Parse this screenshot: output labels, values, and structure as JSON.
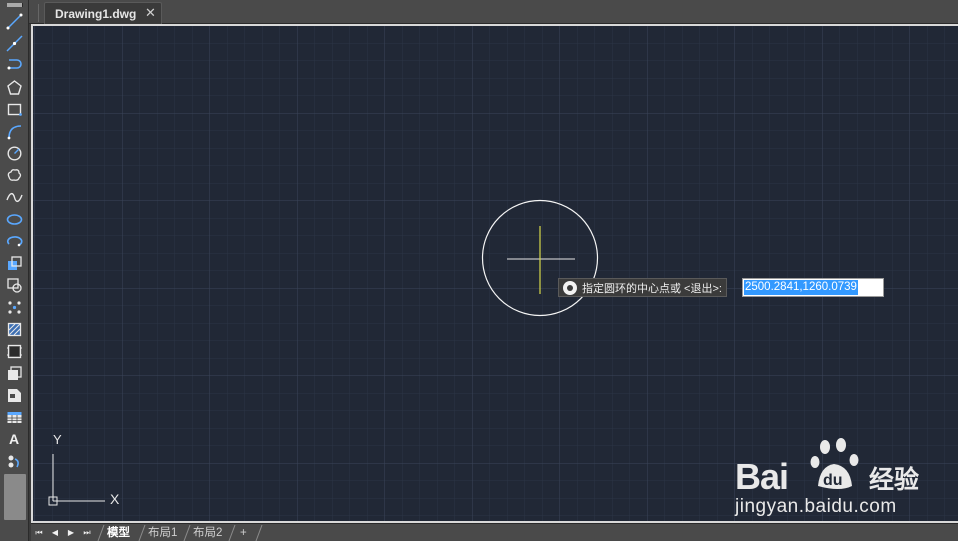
{
  "tab": {
    "title": "Drawing1.dwg",
    "close_glyph": "✕"
  },
  "toolbar": {
    "tools": [
      "line-icon",
      "construction-line-icon",
      "polyline-icon",
      "polygon-icon",
      "rectangle-icon",
      "arc-icon",
      "circle-icon",
      "revision-cloud-icon",
      "spline-icon",
      "ellipse-icon",
      "ellipse-arc-icon",
      "insert-block-icon",
      "make-block-icon",
      "point-icon",
      "hatch-icon",
      "gradient-icon",
      "region-icon",
      "wipeout-icon",
      "table-icon",
      "multiline-text-icon",
      "add-selected-icon"
    ],
    "text_tool": "A"
  },
  "command": {
    "prompt": "指定圆环的中心点或 <退出>:",
    "coordinates": "2500.2841,1260.0739"
  },
  "ucs": {
    "x_label": "X",
    "y_label": "Y"
  },
  "layout_tabs": {
    "model": "模型",
    "layout1": "布局1",
    "layout2": "布局2",
    "add": "+"
  },
  "nav": {
    "first": "⏮",
    "prev": "◀",
    "next": "▶",
    "last": "⏭"
  },
  "watermark": {
    "logo_text": "Bai",
    "logo_suffix": "du",
    "brand": "经验",
    "url": "jingyan.baidu.com"
  },
  "colors": {
    "canvas": "#212836",
    "grid": "#2e3748",
    "grid_major": "#39445a",
    "accent": "#3399ff",
    "crosshair": "#d8d84a"
  }
}
